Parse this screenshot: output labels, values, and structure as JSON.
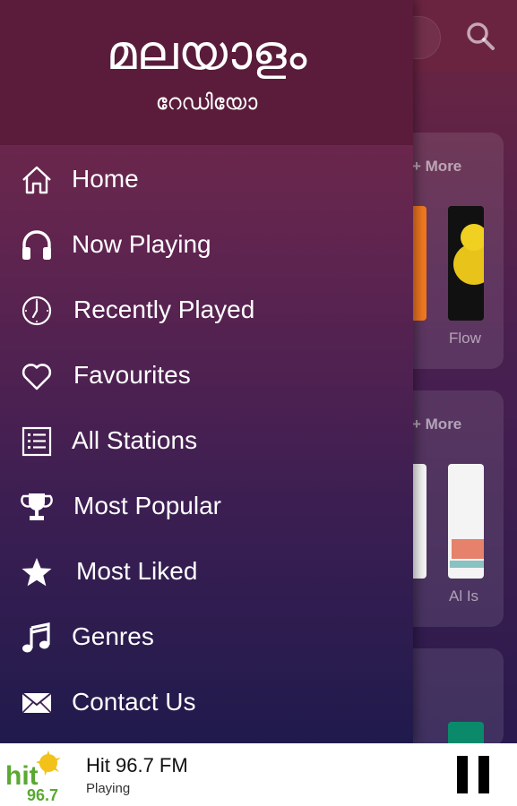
{
  "app": {
    "search_icon": "search-icon",
    "sections": [
      {
        "more_label": "+ More",
        "station_label": "Flow"
      },
      {
        "more_label": "+ More",
        "station_label": "Al Is"
      }
    ]
  },
  "drawer": {
    "title": "മലയാളം",
    "subtitle": "റേഡിയോ",
    "items": [
      {
        "label": "Home",
        "icon": "home-icon"
      },
      {
        "label": "Now Playing",
        "icon": "headphones-icon"
      },
      {
        "label": "Recently Played",
        "icon": "clock-icon"
      },
      {
        "label": "Favourites",
        "icon": "heart-icon"
      },
      {
        "label": "All Stations",
        "icon": "list-icon"
      },
      {
        "label": "Most Popular",
        "icon": "trophy-icon"
      },
      {
        "label": "Most Liked",
        "icon": "star-icon"
      },
      {
        "label": "Genres",
        "icon": "music-note-icon"
      },
      {
        "label": "Contact Us",
        "icon": "envelope-icon"
      }
    ]
  },
  "player": {
    "station": "Hit 96.7 FM",
    "status": "Playing",
    "logo_text": "hit",
    "logo_number": "96.7",
    "pause_icon": "pause-icon"
  },
  "colors": {
    "drawer_header": "#5a1c3a",
    "drawer_gradient_top": "#7a2a46",
    "drawer_gradient_bottom": "#201a4c",
    "player_bg": "#ffffff",
    "logo_green": "#5aa832",
    "logo_yellow": "#f2c21a"
  }
}
